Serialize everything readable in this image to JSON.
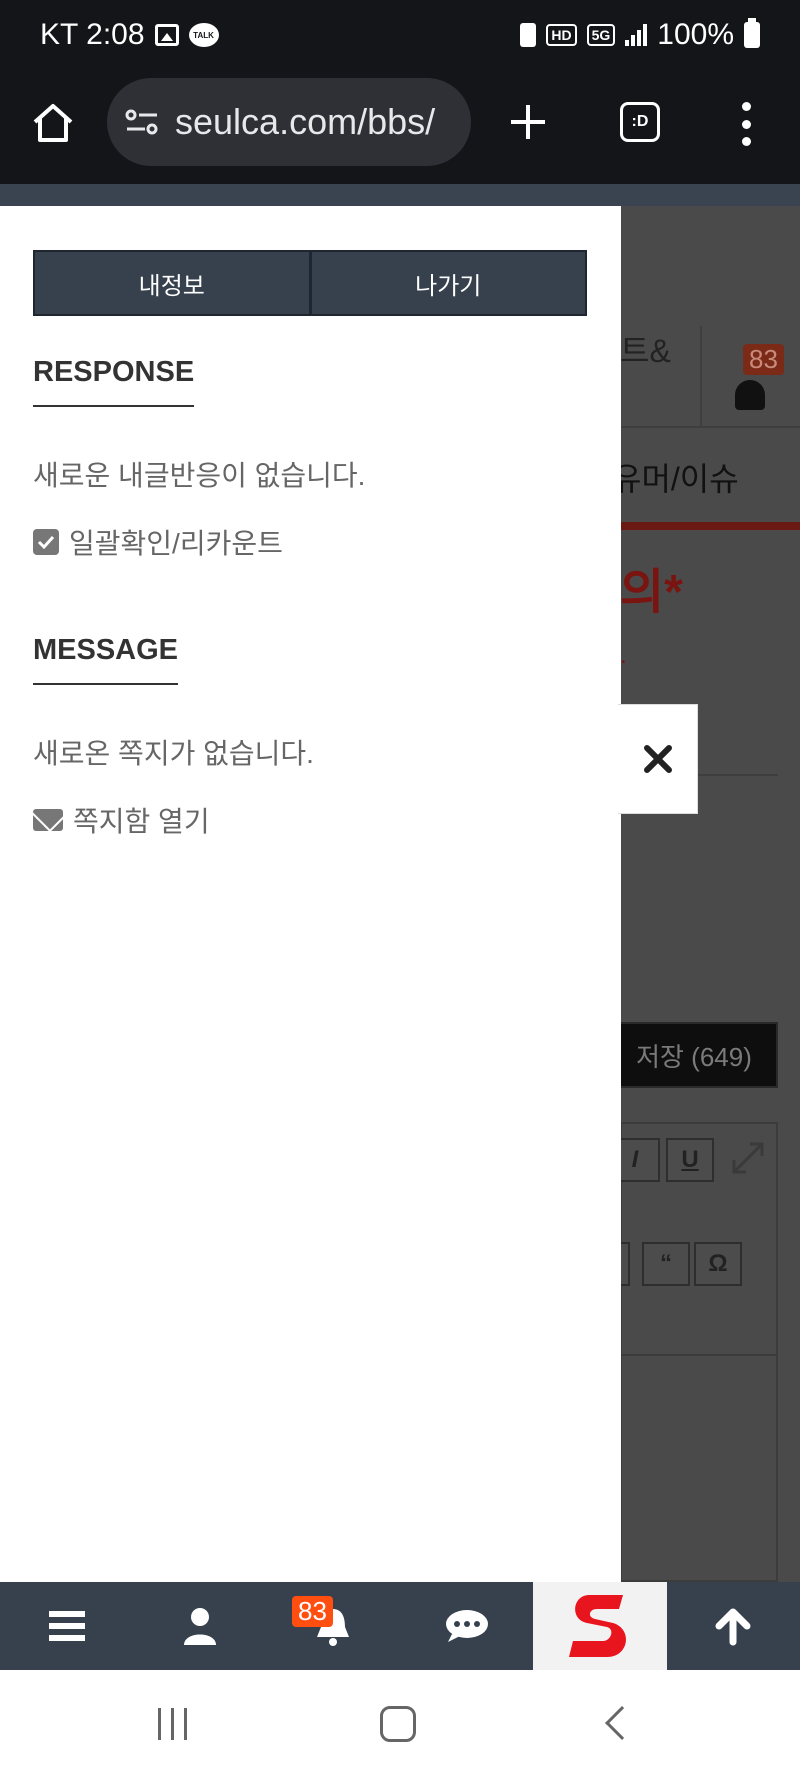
{
  "status_bar": {
    "carrier_time": "KT 2:08",
    "talk_label": "TALK",
    "hd_label": "HD",
    "network_label": "5G",
    "battery": "100%"
  },
  "browser": {
    "url": "seulca.com/bbs/",
    "tabs_label": ":D"
  },
  "background_page": {
    "nav_partial_1": "트&",
    "notification_count": "83",
    "nav_partial_2": "유머/이슈",
    "title_partial": "의*",
    "red_dot": ".",
    "save_button": "저장 (649)",
    "editor_italic": "I",
    "editor_underline": "U",
    "editor_quote": "“",
    "editor_omega": "Ω"
  },
  "drawer": {
    "my_info_button": "내정보",
    "logout_button": "나가기",
    "response": {
      "title": "RESPONSE",
      "empty_text": "새로운 내글반응이 없습니다.",
      "link_label": "일괄확인/리카운트"
    },
    "message": {
      "title": "MESSAGE",
      "empty_text": "새로온 쪽지가 없습니다.",
      "link_label": "쪽지함 열기"
    }
  },
  "bottom_bar": {
    "notification_badge": "83"
  },
  "colors": {
    "drawer_button_bg": "#36414d",
    "appbar_bg": "#36414d",
    "badge": "#ff4e10",
    "logo_red": "#e8141e"
  }
}
